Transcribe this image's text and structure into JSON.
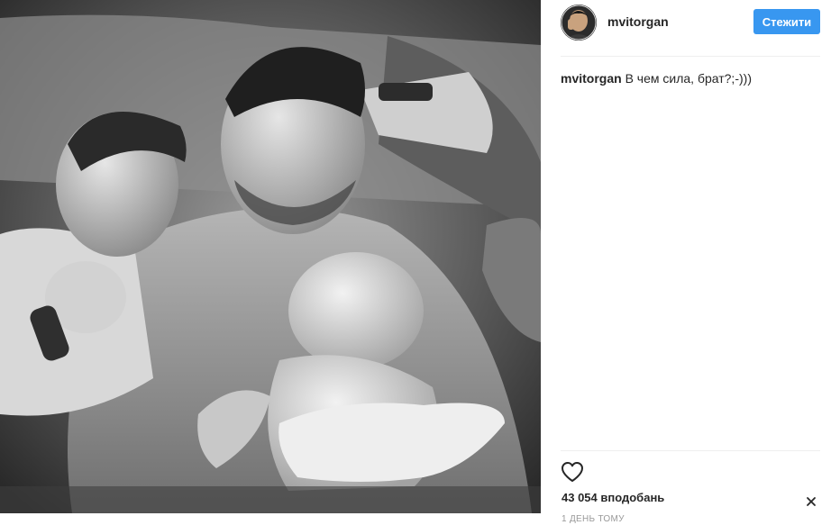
{
  "post": {
    "username": "mvitorgan",
    "follow_label": "Стежити",
    "caption_author": "mvitorgan",
    "caption_text": "В чем сила, брат?;-)))",
    "likes": "43 054 вподобань",
    "time_ago": "1 ДЕНЬ ТОМУ"
  },
  "colors": {
    "follow_button": "#3897f0",
    "text_primary": "#262626",
    "text_muted": "#999999",
    "divider": "#efefef"
  },
  "icons": {
    "like": "heart-outline-icon",
    "more": "close-x-icon"
  }
}
